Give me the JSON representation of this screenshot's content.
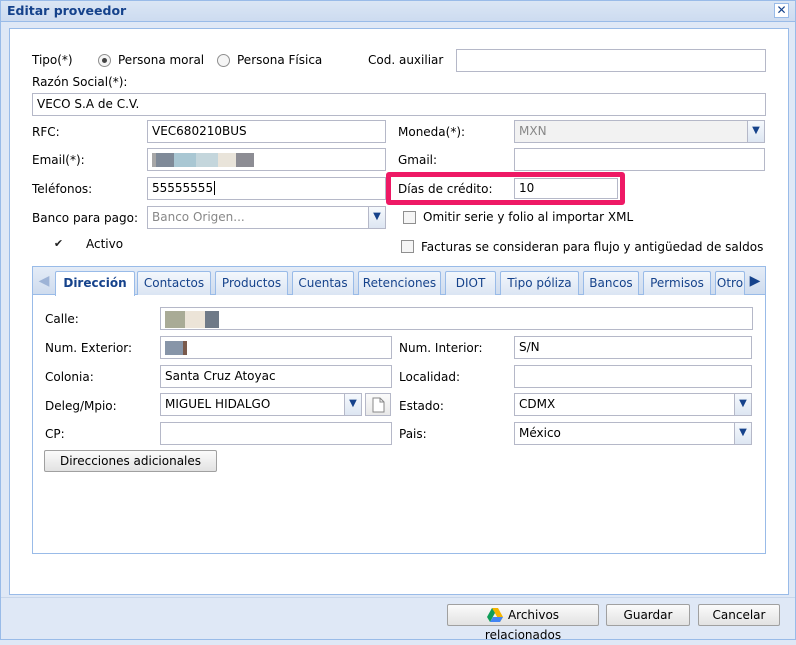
{
  "window": {
    "title": "Editar proveedor"
  },
  "form": {
    "tipo_label": "Tipo(*)",
    "tipo_options": [
      "Persona moral",
      "Persona Física"
    ],
    "cod_auxiliar_label": "Cod. auxiliar",
    "cod_auxiliar_value": "",
    "razon_social_label": "Razón Social(*):",
    "razon_social_value": "VECO S.A de C.V.",
    "rfc_label": "RFC:",
    "rfc_value": "VEC680210BUS",
    "moneda_label": "Moneda(*):",
    "moneda_value": "MXN",
    "email_label": "Email(*):",
    "gmail_label": "Gmail:",
    "gmail_value": "",
    "telefonos_label": "Teléfonos:",
    "telefonos_value": "55555555",
    "dias_credito_label": "Días de crédito:",
    "dias_credito_value": "10",
    "banco_label": "Banco para pago:",
    "banco_placeholder": "Banco Origen...",
    "omitir_label": "Omitir serie y folio al importar XML",
    "activo_label": "Activo",
    "facturas_label": "Facturas se consideran para flujo y antigüedad de saldos"
  },
  "tabs": [
    "Dirección",
    "Contactos",
    "Productos",
    "Cuentas",
    "Retenciones",
    "DIOT",
    "Tipo póliza",
    "Bancos",
    "Permisos",
    "Otro"
  ],
  "direccion": {
    "calle_label": "Calle:",
    "num_ext_label": "Num. Exterior:",
    "num_int_label": "Num. Interior:",
    "num_int_value": "S/N",
    "colonia_label": "Colonia:",
    "colonia_value": "Santa Cruz Atoyac",
    "localidad_label": "Localidad:",
    "localidad_value": "",
    "deleg_label": "Deleg/Mpio:",
    "deleg_value": "MIGUEL HIDALGO",
    "estado_label": "Estado:",
    "estado_value": "CDMX",
    "cp_label": "CP:",
    "cp_value": "",
    "pais_label": "Pais:",
    "pais_value": "México",
    "direcciones_btn": "Direcciones adicionales"
  },
  "footer": {
    "archivos_btn": "Archivos relacionados",
    "guardar_btn": "Guardar",
    "cancelar_btn": "Cancelar"
  },
  "colors": {
    "highlight": "#ee1965",
    "accent": "#15428b"
  }
}
